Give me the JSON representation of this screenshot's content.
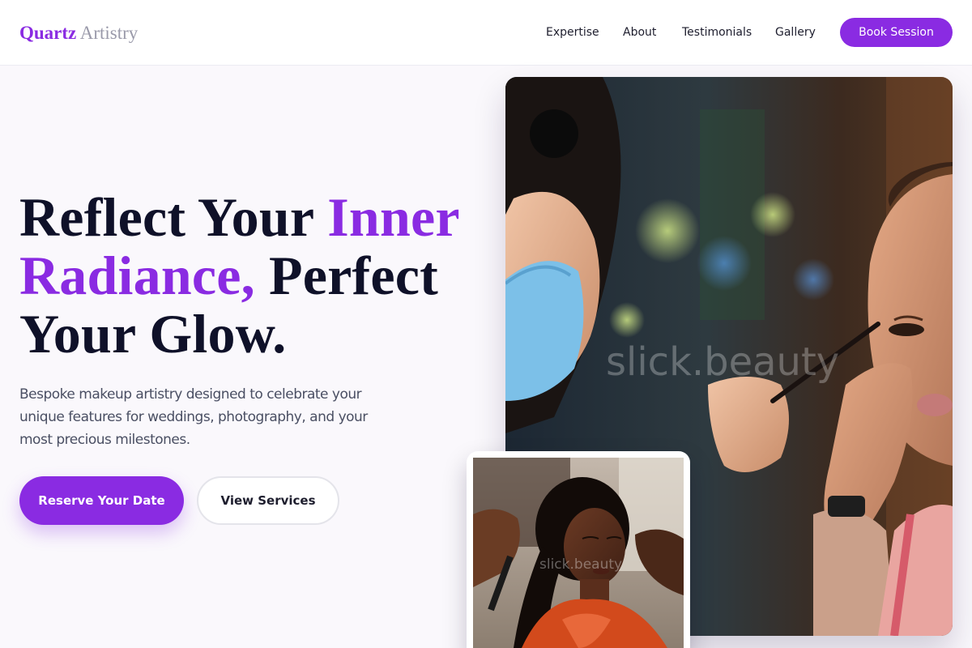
{
  "brand": {
    "name_strong": "Quartz",
    "name_light": "Artistry"
  },
  "nav": {
    "links": [
      "Expertise",
      "About",
      "Testimonials",
      "Gallery"
    ],
    "cta": "Book Session"
  },
  "hero": {
    "headline_part1": "Reflect Your ",
    "headline_accent1": "Inner",
    "headline_accent2": "Radiance,",
    "headline_part2": " Perfect",
    "headline_part3": "Your Glow.",
    "subtext": "Bespoke makeup artistry designed to celebrate your unique features for weddings, photography, and your most precious milestones.",
    "primary_cta": "Reserve Your Date",
    "secondary_cta": "View Services"
  },
  "images": {
    "main_watermark": "slick.beauty",
    "small_watermark": "slick.beauty"
  },
  "colors": {
    "accent": "#8a2be2",
    "text": "#0f1129",
    "muted": "#4a4f63"
  }
}
